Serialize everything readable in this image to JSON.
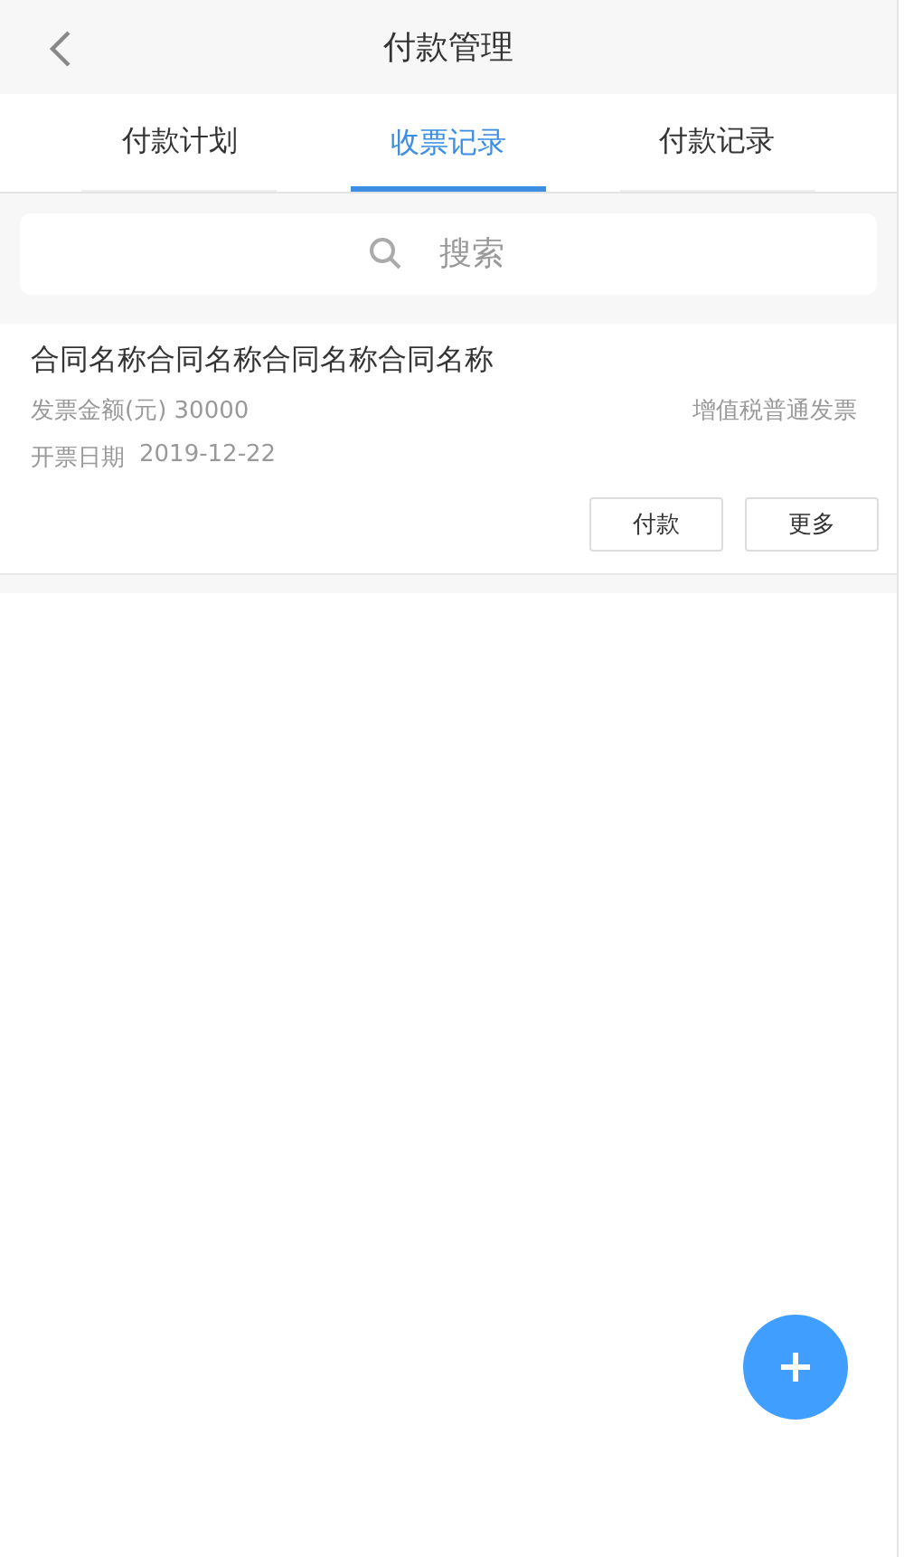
{
  "header": {
    "title": "付款管理"
  },
  "tabs": [
    {
      "label": "付款计划",
      "selected": false
    },
    {
      "label": "收票记录",
      "selected": true
    },
    {
      "label": "付款记录",
      "selected": false
    }
  ],
  "search": {
    "placeholder": "搜索"
  },
  "records": [
    {
      "name": "合同名称合同名称合同名称合同名称",
      "amount": "发票金额(元) 30000",
      "invoice_type": "增值税普通发票",
      "date_label": "开票日期",
      "date": "2019-12-22",
      "actions": [
        "付款",
        "更多"
      ]
    }
  ],
  "fab": {
    "kind": "add"
  }
}
